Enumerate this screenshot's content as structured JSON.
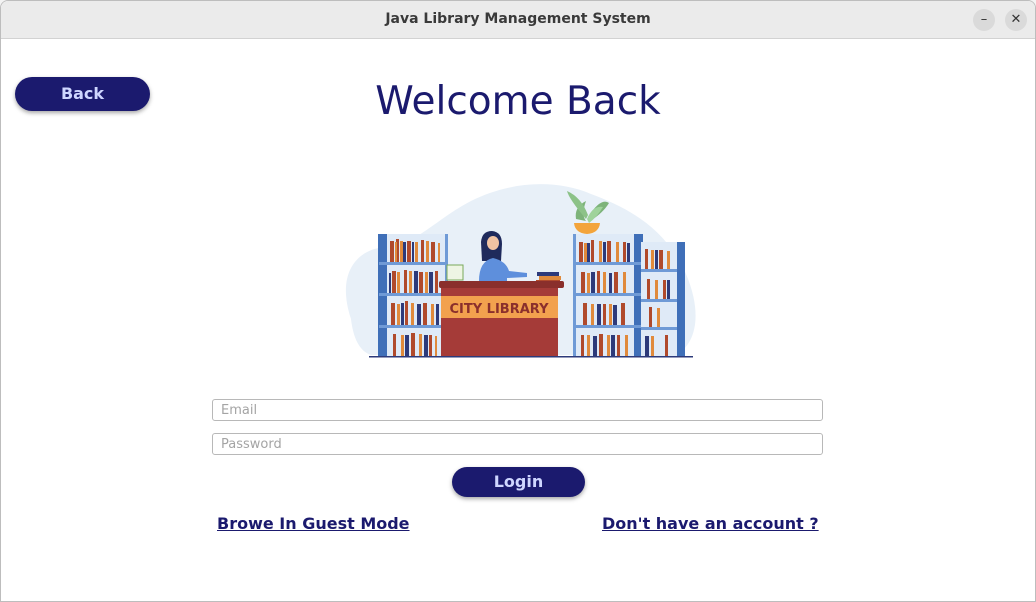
{
  "window": {
    "title": "Java Library Management System",
    "minimize_glyph": "–",
    "close_glyph": "✕"
  },
  "header": {
    "back_label": "Back",
    "heading": "Welcome Back"
  },
  "illustration": {
    "sign_text": "CITY LIBRARY"
  },
  "form": {
    "email_placeholder": "Email",
    "email_value": "",
    "password_placeholder": "Password",
    "password_value": "",
    "login_label": "Login"
  },
  "links": {
    "guest": "Browe In Guest Mode",
    "signup": "Don't have an account ?"
  },
  "colors": {
    "primary": "#1b1a6e",
    "button_text": "#cfd6ff",
    "desk": "#a53b38",
    "shelf": "#3f6fb8"
  },
  "icons": {
    "minimize": "minimize-icon",
    "close": "close-icon",
    "illustration": "library-illustration"
  }
}
